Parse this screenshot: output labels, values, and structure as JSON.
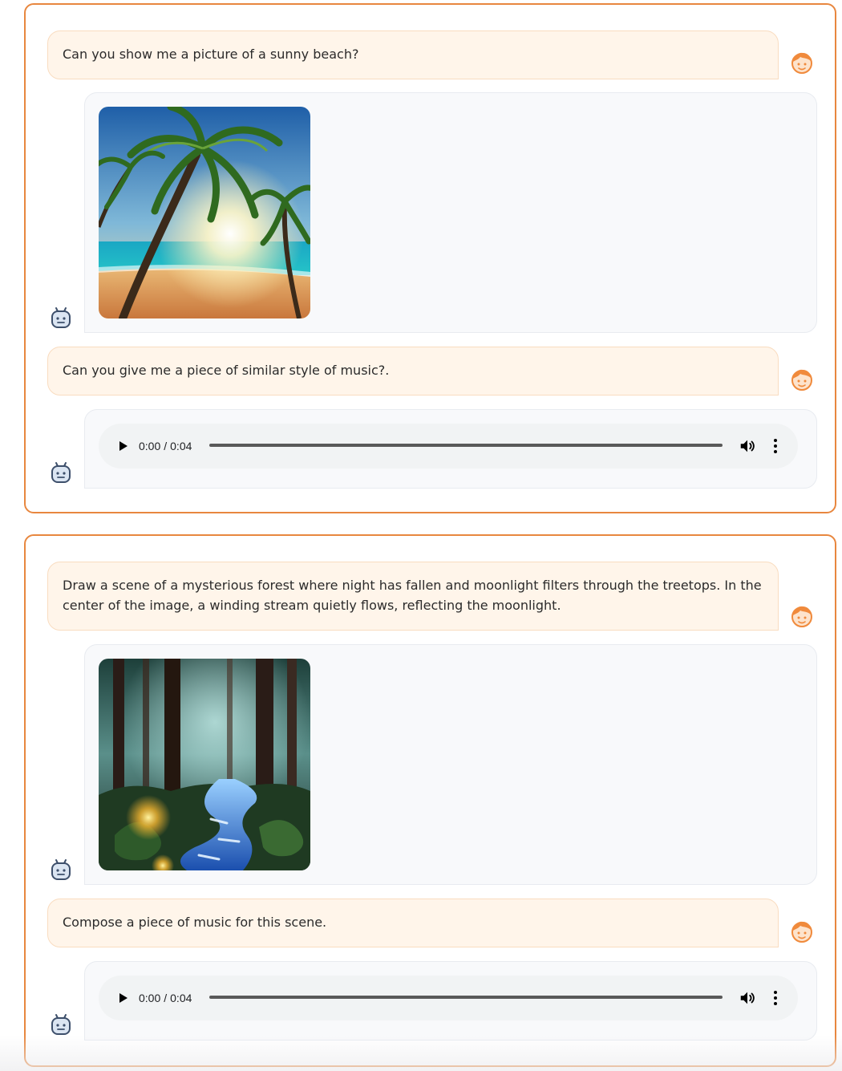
{
  "conversations": [
    {
      "turns": [
        {
          "role": "user",
          "text": "Can you show me a picture of a sunny beach?"
        },
        {
          "role": "bot",
          "media": "image",
          "image_subject": "sunny beach with palm trees"
        },
        {
          "role": "user",
          "text": "Can you give me a piece of similar style of music?."
        },
        {
          "role": "bot",
          "media": "audio",
          "current_time": "0:00",
          "duration": "0:04",
          "progress": 0
        }
      ]
    },
    {
      "turns": [
        {
          "role": "user",
          "text": "Draw a scene of a mysterious forest where night has fallen and moonlight filters through the treetops. In the center of the image, a winding stream quietly flows, reflecting the moonlight."
        },
        {
          "role": "bot",
          "media": "image",
          "image_subject": "moonlit forest with winding stream"
        },
        {
          "role": "user",
          "text": "Compose a piece of music for this scene."
        },
        {
          "role": "bot",
          "media": "audio",
          "current_time": "0:00",
          "duration": "0:04",
          "progress": 0
        }
      ]
    }
  ],
  "audio_time_separator": "/",
  "icons": {
    "user_avatar": "user-avatar-icon",
    "bot_avatar": "bot-avatar-icon",
    "play": "play-icon",
    "volume": "volume-icon",
    "more": "more-vert-icon"
  },
  "colors": {
    "panel_border": "#e8873f",
    "user_bubble_bg": "#fff5ea",
    "bot_bubble_bg": "#f8f9fb",
    "user_avatar": "#f08a3c",
    "bot_avatar": "#3d4f6b"
  }
}
